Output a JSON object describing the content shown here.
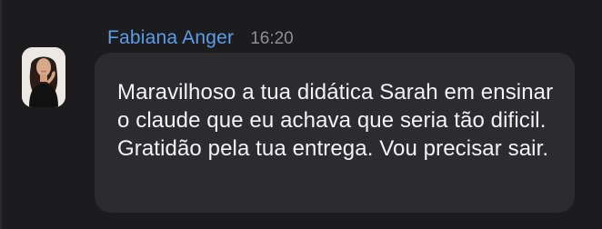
{
  "message": {
    "sender_name": "Fabiana Anger",
    "timestamp": "16:20",
    "text": "Maravilhoso a tua didática Sarah em ensinar o claude que eu achava que seria tão dificil. Gratidão pela tua entrega. Vou precisar sair.",
    "avatar_icon": "user-photo-avatar"
  },
  "colors": {
    "background": "#1c1c1e",
    "bubble": "#2c2c2e",
    "sender_name": "#5a9ee8",
    "timestamp": "#8e8e93",
    "message_text": "#f2f2f7"
  }
}
